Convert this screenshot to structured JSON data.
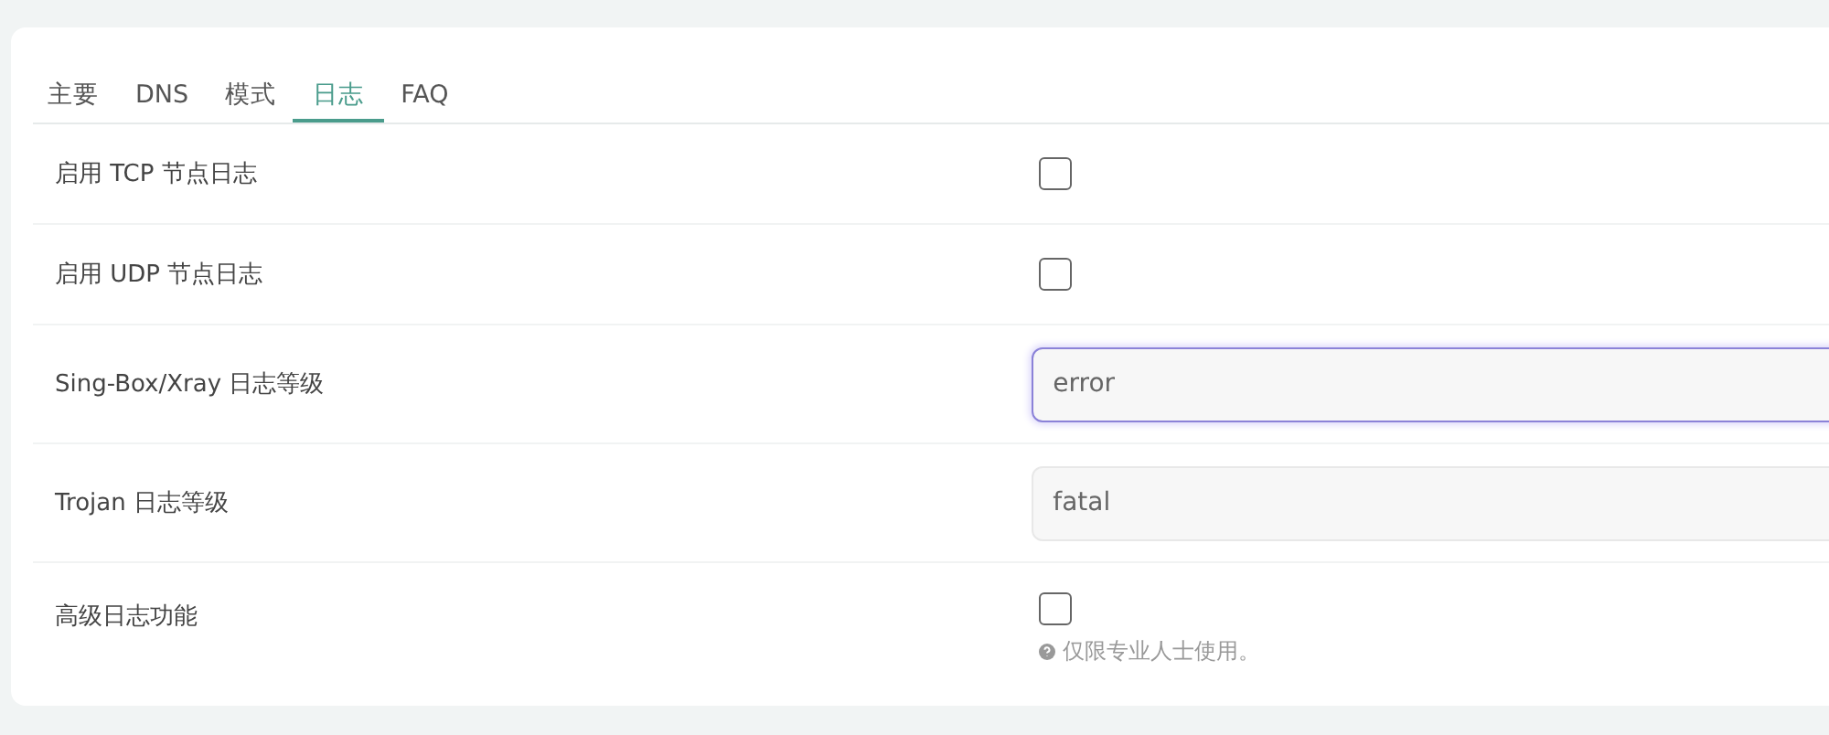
{
  "tabs": [
    {
      "label": "主要",
      "selected": false
    },
    {
      "label": "DNS",
      "selected": false
    },
    {
      "label": "模式",
      "selected": false
    },
    {
      "label": "日志",
      "selected": true
    },
    {
      "label": "FAQ",
      "selected": false
    }
  ],
  "rows": [
    {
      "label": "启用 TCP 节点日志",
      "kind": "checkbox",
      "checked": false
    },
    {
      "label": "启用 UDP 节点日志",
      "kind": "checkbox",
      "checked": false
    },
    {
      "label": "Sing-Box/Xray 日志等级",
      "kind": "select",
      "value": "error",
      "focused": true
    },
    {
      "label": "Trojan 日志等级",
      "kind": "select",
      "value": "fatal",
      "focused": false
    },
    {
      "label": "高级日志功能",
      "kind": "checkbox",
      "checked": false,
      "hint": "仅限专业人士使用。"
    }
  ]
}
